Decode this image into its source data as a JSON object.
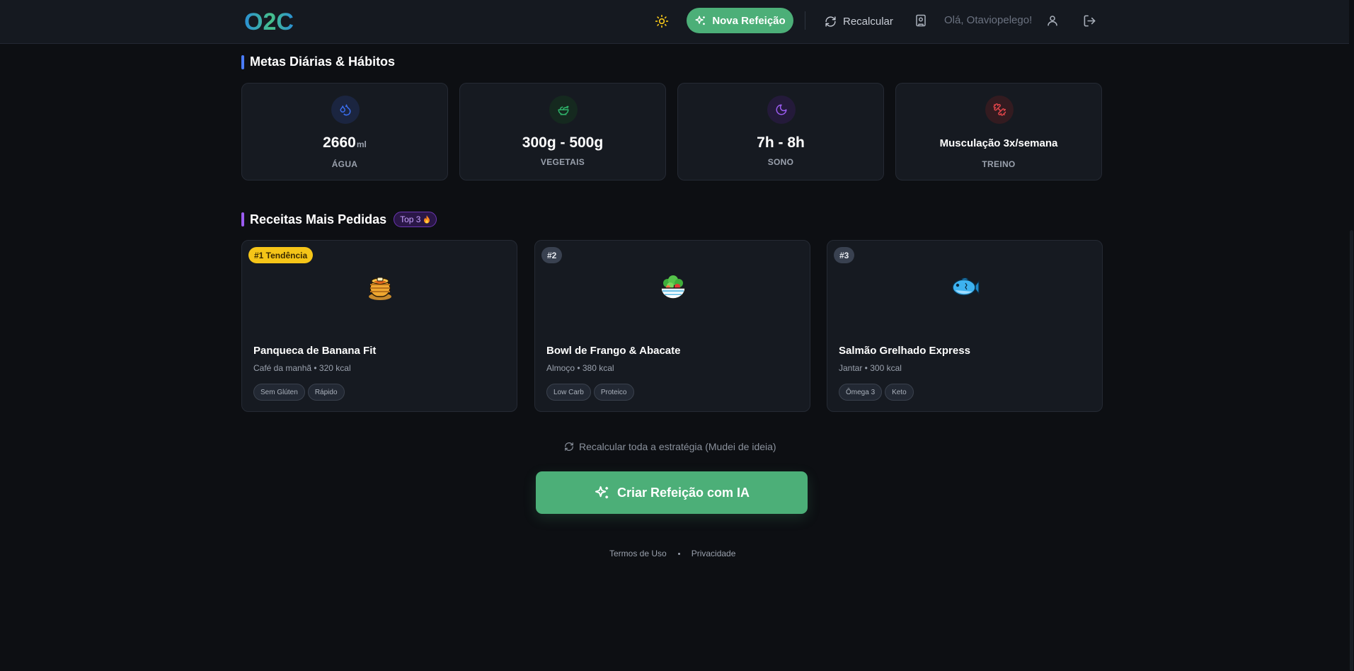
{
  "header": {
    "logo_text": "O2C",
    "new_meal_label": "Nova Refeição",
    "recalc_label": "Recalcular",
    "greeting": "Olá, Otaviopelego!",
    "icons": [
      "sun-icon",
      "sparkles-icon",
      "refresh-icon",
      "book-icon",
      "user-icon",
      "logout-icon"
    ]
  },
  "goals": {
    "title": "Metas Diárias & Hábitos",
    "accent": "#4a7cff",
    "items": [
      {
        "value": "2660",
        "unit": "ml",
        "label": "ÁGUA",
        "icon": "droplets-icon",
        "color": "#3b6ff0"
      },
      {
        "value": "300g - 500g",
        "label": "VEGETAIS",
        "icon": "salad-icon",
        "color": "#2fb36a"
      },
      {
        "value": "7h - 8h",
        "label": "SONO",
        "icon": "moon-icon",
        "color": "#9b5cf0"
      },
      {
        "value": "Musculação 3x/semana",
        "label": "TREINO",
        "icon": "dumbbell-icon",
        "color": "#e0454a"
      }
    ]
  },
  "recipes": {
    "title": "Receitas Mais Pedidas",
    "badge": "Top 3",
    "accent": "#9b5cf0",
    "items": [
      {
        "rank": "#1 Tendência",
        "emoji": "pancakes-icon",
        "name": "Panqueca de Banana Fit",
        "meta": "Café da manhã • 320 kcal",
        "tags": [
          "Sem Glúten",
          "Rápido"
        ]
      },
      {
        "rank": "#2",
        "emoji": "salad-bowl-icon",
        "name": "Bowl de Frango & Abacate",
        "meta": "Almoço • 380 kcal",
        "tags": [
          "Low Carb",
          "Proteico"
        ]
      },
      {
        "rank": "#3",
        "emoji": "fish-icon",
        "name": "Salmão Grelhado Express",
        "meta": "Jantar • 300 kcal",
        "tags": [
          "Ômega 3",
          "Keto"
        ]
      }
    ]
  },
  "actions": {
    "recalc_link": "Recalcular toda a estratégia (Mudei de ideia)",
    "cta": "Criar Refeição com IA",
    "brand_green": "#4caf78"
  },
  "footer": {
    "terms": "Termos de Uso",
    "privacy": "Privacidade"
  }
}
